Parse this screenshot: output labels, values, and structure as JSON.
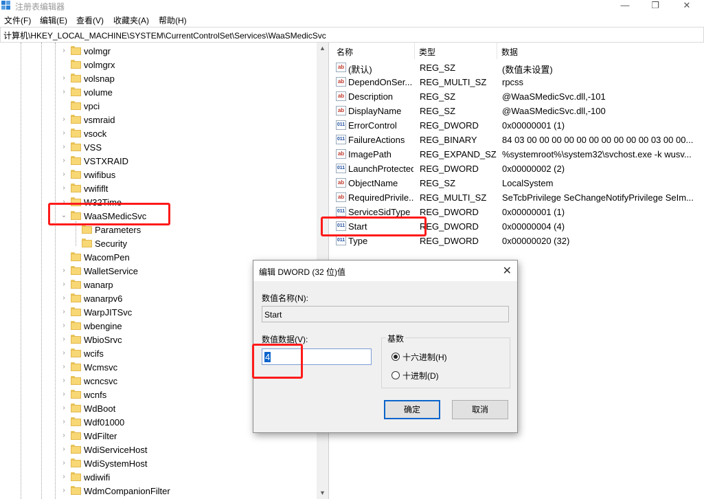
{
  "window": {
    "title": "注册表编辑器",
    "minimize": "—",
    "maximize": "❐",
    "close": "✕"
  },
  "menu": [
    "文件(F)",
    "编辑(E)",
    "查看(V)",
    "收藏夹(A)",
    "帮助(H)"
  ],
  "address": "计算机\\HKEY_LOCAL_MACHINE\\SYSTEM\\CurrentControlSet\\Services\\WaaSMedicSvc",
  "tree": [
    {
      "label": "volmgr",
      "expand": true,
      "level": 0
    },
    {
      "label": "volmgrx",
      "expand": false,
      "level": 0
    },
    {
      "label": "volsnap",
      "expand": true,
      "level": 0
    },
    {
      "label": "volume",
      "expand": true,
      "level": 0
    },
    {
      "label": "vpci",
      "expand": false,
      "level": 0
    },
    {
      "label": "vsmraid",
      "expand": true,
      "level": 0
    },
    {
      "label": "vsock",
      "expand": true,
      "level": 0
    },
    {
      "label": "VSS",
      "expand": true,
      "level": 0
    },
    {
      "label": "VSTXRAID",
      "expand": true,
      "level": 0
    },
    {
      "label": "vwifibus",
      "expand": true,
      "level": 0
    },
    {
      "label": "vwififlt",
      "expand": true,
      "level": 0
    },
    {
      "label": "W32Time",
      "expand": true,
      "level": 0
    },
    {
      "label": "WaaSMedicSvc",
      "expand": "open",
      "level": 0
    },
    {
      "label": "Parameters",
      "expand": false,
      "level": 1
    },
    {
      "label": "Security",
      "expand": false,
      "level": 1
    },
    {
      "label": "WacomPen",
      "expand": false,
      "level": 0
    },
    {
      "label": "WalletService",
      "expand": true,
      "level": 0
    },
    {
      "label": "wanarp",
      "expand": true,
      "level": 0
    },
    {
      "label": "wanarpv6",
      "expand": true,
      "level": 0
    },
    {
      "label": "WarpJITSvc",
      "expand": true,
      "level": 0
    },
    {
      "label": "wbengine",
      "expand": true,
      "level": 0
    },
    {
      "label": "WbioSrvc",
      "expand": true,
      "level": 0
    },
    {
      "label": "wcifs",
      "expand": true,
      "level": 0
    },
    {
      "label": "Wcmsvc",
      "expand": true,
      "level": 0
    },
    {
      "label": "wcncsvc",
      "expand": true,
      "level": 0
    },
    {
      "label": "wcnfs",
      "expand": true,
      "level": 0
    },
    {
      "label": "WdBoot",
      "expand": true,
      "level": 0
    },
    {
      "label": "Wdf01000",
      "expand": true,
      "level": 0
    },
    {
      "label": "WdFilter",
      "expand": true,
      "level": 0
    },
    {
      "label": "WdiServiceHost",
      "expand": true,
      "level": 0
    },
    {
      "label": "WdiSystemHost",
      "expand": true,
      "level": 0
    },
    {
      "label": "wdiwifi",
      "expand": true,
      "level": 0
    },
    {
      "label": "WdmCompanionFilter",
      "expand": true,
      "level": 0
    }
  ],
  "columns": [
    "名称",
    "类型",
    "数据"
  ],
  "values": [
    {
      "icon": "ab",
      "name": "(默认)",
      "type": "REG_SZ",
      "data": "(数值未设置)"
    },
    {
      "icon": "ab",
      "name": "DependOnSer...",
      "type": "REG_MULTI_SZ",
      "data": "rpcss"
    },
    {
      "icon": "ab",
      "name": "Description",
      "type": "REG_SZ",
      "data": "@WaaSMedicSvc.dll,-101"
    },
    {
      "icon": "ab",
      "name": "DisplayName",
      "type": "REG_SZ",
      "data": "@WaaSMedicSvc.dll,-100"
    },
    {
      "icon": "bin",
      "name": "ErrorControl",
      "type": "REG_DWORD",
      "data": "0x00000001 (1)"
    },
    {
      "icon": "bin",
      "name": "FailureActions",
      "type": "REG_BINARY",
      "data": "84 03 00 00 00 00 00 00 00 00 00 00 03 00 00..."
    },
    {
      "icon": "ab",
      "name": "ImagePath",
      "type": "REG_EXPAND_SZ",
      "data": "%systemroot%\\system32\\svchost.exe -k wusv..."
    },
    {
      "icon": "bin",
      "name": "LaunchProtected",
      "type": "REG_DWORD",
      "data": "0x00000002 (2)"
    },
    {
      "icon": "ab",
      "name": "ObjectName",
      "type": "REG_SZ",
      "data": "LocalSystem"
    },
    {
      "icon": "ab",
      "name": "RequiredPrivile...",
      "type": "REG_MULTI_SZ",
      "data": "SeTcbPrivilege SeChangeNotifyPrivilege SeIm..."
    },
    {
      "icon": "bin",
      "name": "ServiceSidType",
      "type": "REG_DWORD",
      "data": "0x00000001 (1)"
    },
    {
      "icon": "bin",
      "name": "Start",
      "type": "REG_DWORD",
      "data": "0x00000004 (4)"
    },
    {
      "icon": "bin",
      "name": "Type",
      "type": "REG_DWORD",
      "data": "0x00000020 (32)"
    }
  ],
  "dialog": {
    "title": "编辑 DWORD (32 位)值",
    "close": "✕",
    "name_label": "数值名称(N):",
    "name_value": "Start",
    "data_label": "数值数据(V):",
    "data_value": "4",
    "base_label": "基数",
    "hex_label": "十六进制(H)",
    "dec_label": "十进制(D)",
    "ok": "确定",
    "cancel": "取消"
  },
  "colors": {
    "annotation": "#ff1a1a",
    "accent": "#0a64cc",
    "folder": "#f8d775"
  }
}
